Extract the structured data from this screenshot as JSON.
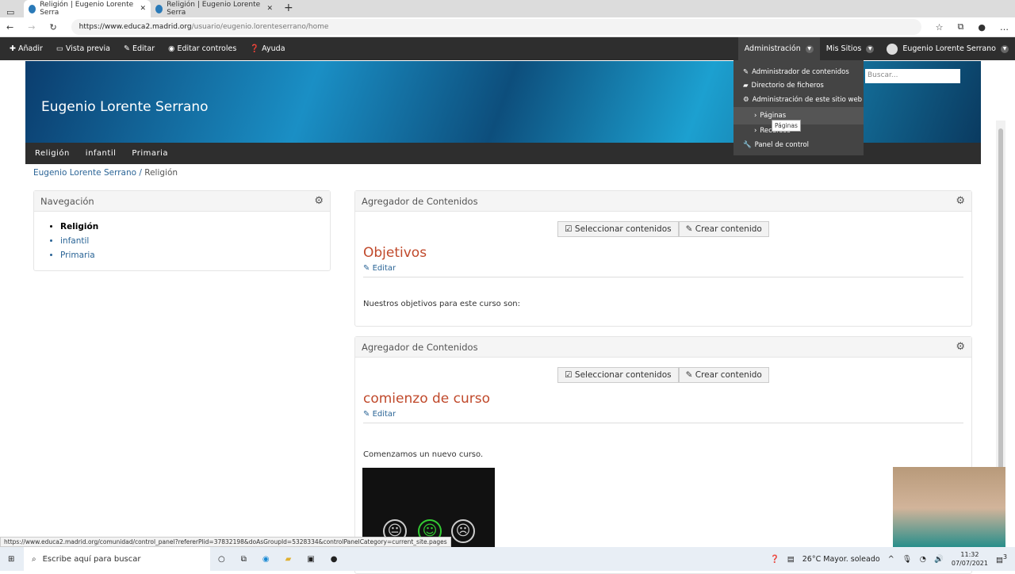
{
  "browser": {
    "tabs": [
      {
        "title": "Religión | Eugenio Lorente Serra"
      },
      {
        "title": "Religión | Eugenio Lorente Serra"
      }
    ],
    "url_domain": "https://www.educa2.madrid.org",
    "url_path": "/usuario/eugenio.lorenteserrano/home"
  },
  "admin_bar": {
    "items": [
      "Añadir",
      "Vista previa",
      "Editar",
      "Editar controles",
      "Ayuda"
    ],
    "right": [
      "Administración",
      "Mis Sitios",
      "Eugenio Lorente Serrano"
    ]
  },
  "dropdown": {
    "items": [
      "Administrador de contenidos",
      "Directorio de ficheros",
      "Administración de este sitio web",
      "Páginas",
      "Recursos",
      "Panel de control"
    ],
    "tooltip": "Páginas"
  },
  "site": {
    "title": "Eugenio Lorente Serrano",
    "search_placeholder": "Buscar...",
    "nav": [
      "Religión",
      "infantil",
      "Primaria"
    ],
    "breadcrumb": [
      "Eugenio Lorente Serrano",
      "Religión"
    ]
  },
  "navigation": {
    "title": "Navegación",
    "items": [
      "Religión",
      "infantil",
      "Primaria"
    ]
  },
  "portlets": [
    {
      "title": "Agregador de Contenidos",
      "select": "Seleccionar contenidos",
      "create": "Crear contenido",
      "article": "Objetivos",
      "edit": "Editar",
      "body": "Nuestros objetivos para este curso son:"
    },
    {
      "title": "Agregador de Contenidos",
      "select": "Seleccionar contenidos",
      "create": "Crear contenido",
      "article": "comienzo de curso",
      "edit": "Editar",
      "body": "Comenzamos un nuevo curso."
    }
  ],
  "status_url": "https://www.educa2.madrid.org/comunidad/control_panel?refererPlid=37832198&doAsGroupId=5328334&controlPanelCategory=current_site.pages",
  "taskbar": {
    "search": "Escribe aquí para buscar",
    "weather": "26°C  Mayor. soleado",
    "time": "11:32",
    "date": "07/07/2021",
    "notifications": "3"
  }
}
